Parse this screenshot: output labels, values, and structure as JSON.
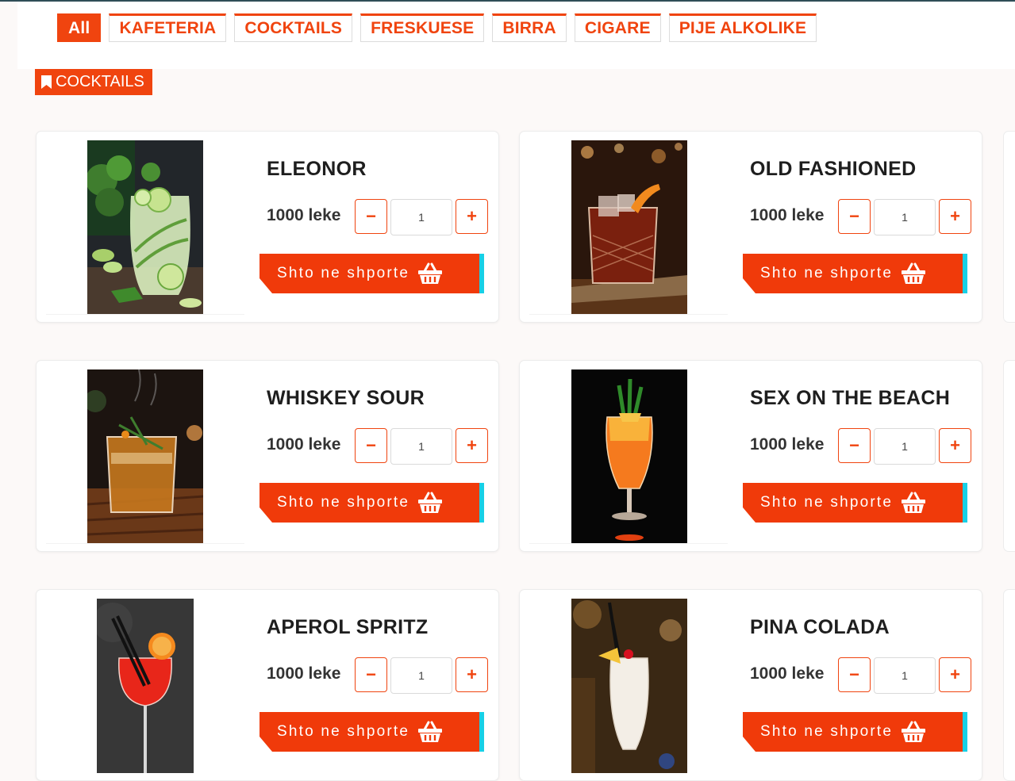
{
  "filters": [
    "All",
    "KAFETERIA",
    "COCKTAILS",
    "FRESKUESE",
    "BIRRA",
    "CIGARE",
    "PIJE ALKOLIKE"
  ],
  "active_filter": "All",
  "section_title": "COCKTAILS",
  "cart_label": "Shto ne shporte",
  "colors": {
    "accent": "#f0440f",
    "cart_button": "#f03a0a",
    "cart_edge": "#17d0e6",
    "background": "#fcf9f8"
  },
  "products": [
    {
      "name": "ELEONOR",
      "price": "1000 leke",
      "qty": "1"
    },
    {
      "name": "OLD FASHIONED",
      "price": "1000 leke",
      "qty": "1"
    },
    {
      "name": "WHISKEY SOUR",
      "price": "1000 leke",
      "qty": "1"
    },
    {
      "name": "SEX ON THE BEACH",
      "price": "1000 leke",
      "qty": "1"
    },
    {
      "name": "APEROL SPRITZ",
      "price": "1000 leke",
      "qty": "1"
    },
    {
      "name": "PINA COLADA",
      "price": "1000 leke",
      "qty": "1"
    }
  ],
  "qty_minus": "−",
  "qty_plus": "+"
}
